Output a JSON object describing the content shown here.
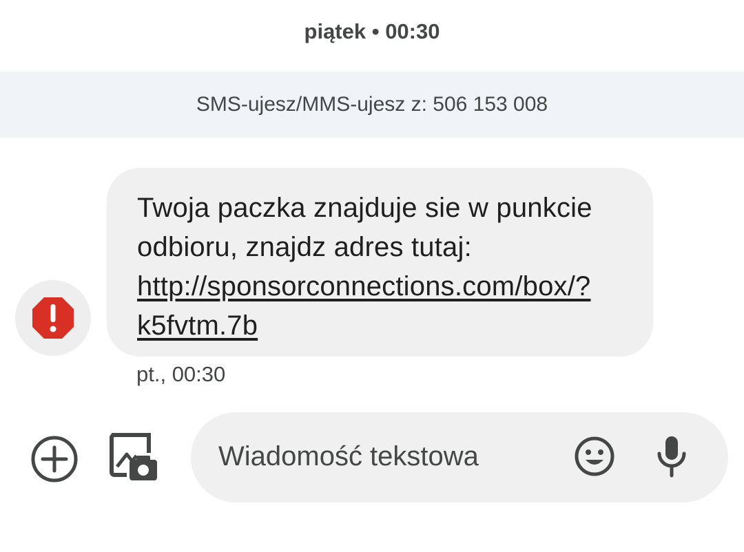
{
  "header": {
    "date_time": "piątek • 00:30"
  },
  "banner": {
    "text": "SMS-ujesz/MMS-ujesz z: 506 153 008"
  },
  "message": {
    "text_before_link": "Twoja paczka znajduje sie w punkcie odbioru, znajdz adres tutaj: ",
    "link_text": "http://sponsorconnections.com/box/?k5fvtm.7b",
    "timestamp": "pt., 00:30",
    "avatar_icon": "warning-octagon-icon",
    "warning_color": "#d93025"
  },
  "compose": {
    "placeholder": "Wiadomość tekstowa",
    "add_icon": "plus-circle-icon",
    "gallery_icon": "gallery-camera-icon",
    "emoji_icon": "emoji-icon",
    "mic_icon": "microphone-icon"
  }
}
